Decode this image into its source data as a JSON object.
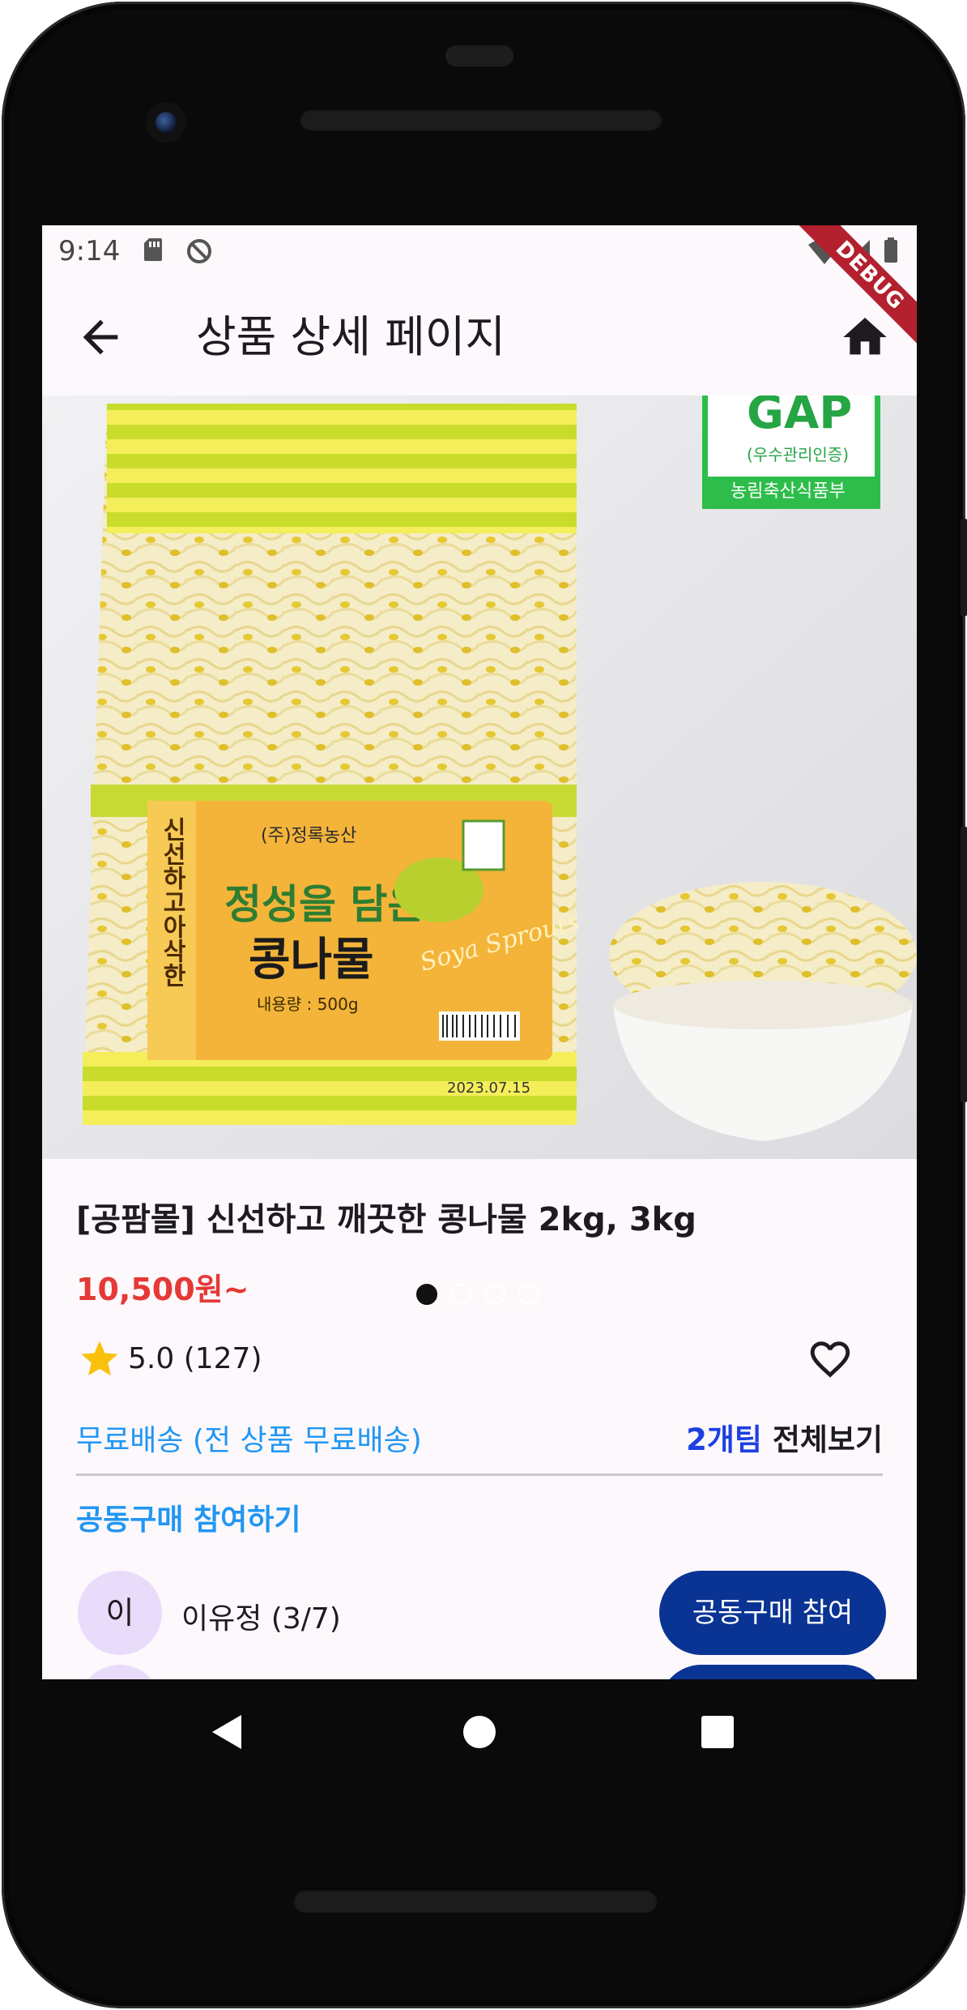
{
  "status_bar": {
    "time": "9:14"
  },
  "debug_banner": "DEBUG",
  "app_bar": {
    "title": "상품 상세 페이지",
    "back_icon": "arrow-back-icon",
    "home_icon": "home-icon"
  },
  "product": {
    "image_text": {
      "title_line1": "정성을 담은",
      "title_line2": "콩나물",
      "vertical": "신선하고아삭한",
      "company": "(주)정록농산",
      "weight": "내용량 : 500g",
      "soya": "Soya Sprouts",
      "gap_badge": "GAP",
      "gap_sub": "(우수관리인증)",
      "ministry": "농림축산식품부",
      "date": "2023.07.15"
    },
    "carousel": {
      "count": 4,
      "active": 0
    },
    "name": "[공팜몰] 신선하고 깨끗한 콩나물 2kg, 3kg",
    "price": "10,500원~",
    "rating": "5.0 (127)",
    "shipping": "무료배송 (전 상품 무료배송)",
    "teams_count": "2개팀",
    "teams_all": "전체보기"
  },
  "group_buy": {
    "section_title": "공동구매 참여하기",
    "members": [
      {
        "initial": "이",
        "name": "이유정 (3/7)",
        "button": "공동구매 참여"
      },
      {
        "initial": "",
        "name": "",
        "button": ""
      }
    ]
  },
  "colors": {
    "accent_blue": "#2196f3",
    "price_red": "#e53935",
    "button_navy": "#0a3494",
    "avatar_bg": "#e9dcfb"
  }
}
